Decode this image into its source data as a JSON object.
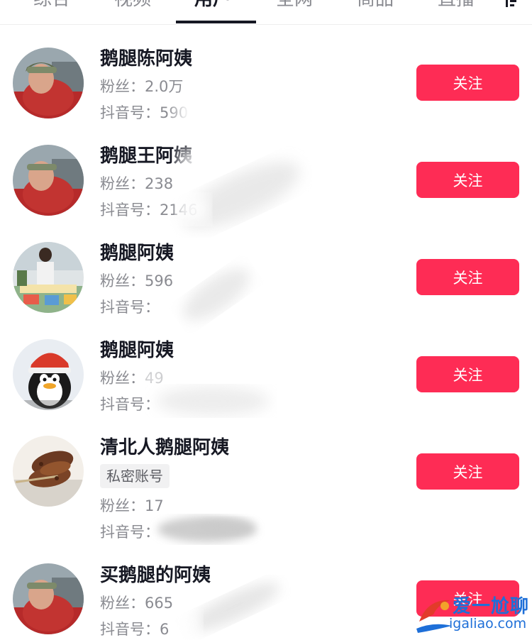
{
  "tabs": [
    {
      "label": "综合",
      "active": false
    },
    {
      "label": "视频",
      "active": false
    },
    {
      "label": "用户",
      "active": true
    },
    {
      "label": "全网",
      "active": false
    },
    {
      "label": "商品",
      "active": false
    },
    {
      "label": "直播",
      "active": false
    }
  ],
  "follow_label": "关注",
  "users": [
    {
      "name": "鹅腿陈阿姨",
      "fans": "粉丝：2.0万",
      "douyin_id": "抖音号：5904",
      "avatar": "woman-red-jacket-avatar"
    },
    {
      "name": "鹅腿王阿姨",
      "fans": "粉丝：238",
      "douyin_id": "抖音号：2146",
      "avatar": "woman-red-jacket-avatar"
    },
    {
      "name": "鹅腿阿姨",
      "fans": "粉丝：596",
      "douyin_id": "抖音号：",
      "avatar": "woman-at-stall-avatar"
    },
    {
      "name": "鹅腿阿姨",
      "fans": "粉丝：49",
      "douyin_id": "抖音号：",
      "avatar": "cartoon-penguin-avatar"
    },
    {
      "name": "清北人鹅腿阿姨",
      "tag": "私密账号",
      "fans": "粉丝：17",
      "douyin_id": "抖音号：",
      "avatar": "grilled-meat-avatar"
    },
    {
      "name": "买鹅腿的阿姨",
      "fans": "粉丝：665",
      "douyin_id": "抖音号：6",
      "avatar": "woman-red-jacket-avatar"
    }
  ],
  "watermark": {
    "line1": "爱一尬聊",
    "line2": "igaliao.com"
  },
  "colors": {
    "accent": "#fe2c55",
    "text": "#161823",
    "secondary": "#8a8b91",
    "watermark": "#1e6fd8"
  }
}
